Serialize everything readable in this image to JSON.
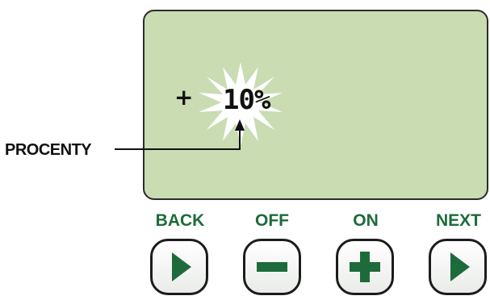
{
  "display": {
    "plus_symbol": "+",
    "value": "10%"
  },
  "callout": {
    "label": "PROCENTY"
  },
  "buttons": {
    "back": {
      "label": "BACK",
      "icon": "play-right-icon"
    },
    "off": {
      "label": "OFF",
      "icon": "minus-icon"
    },
    "on": {
      "label": "ON",
      "icon": "plus-icon"
    },
    "next": {
      "label": "NEXT",
      "icon": "play-right-icon"
    }
  },
  "colors": {
    "lcd_background": "#c9dcb2",
    "button_accent": "#1d6b3b"
  }
}
